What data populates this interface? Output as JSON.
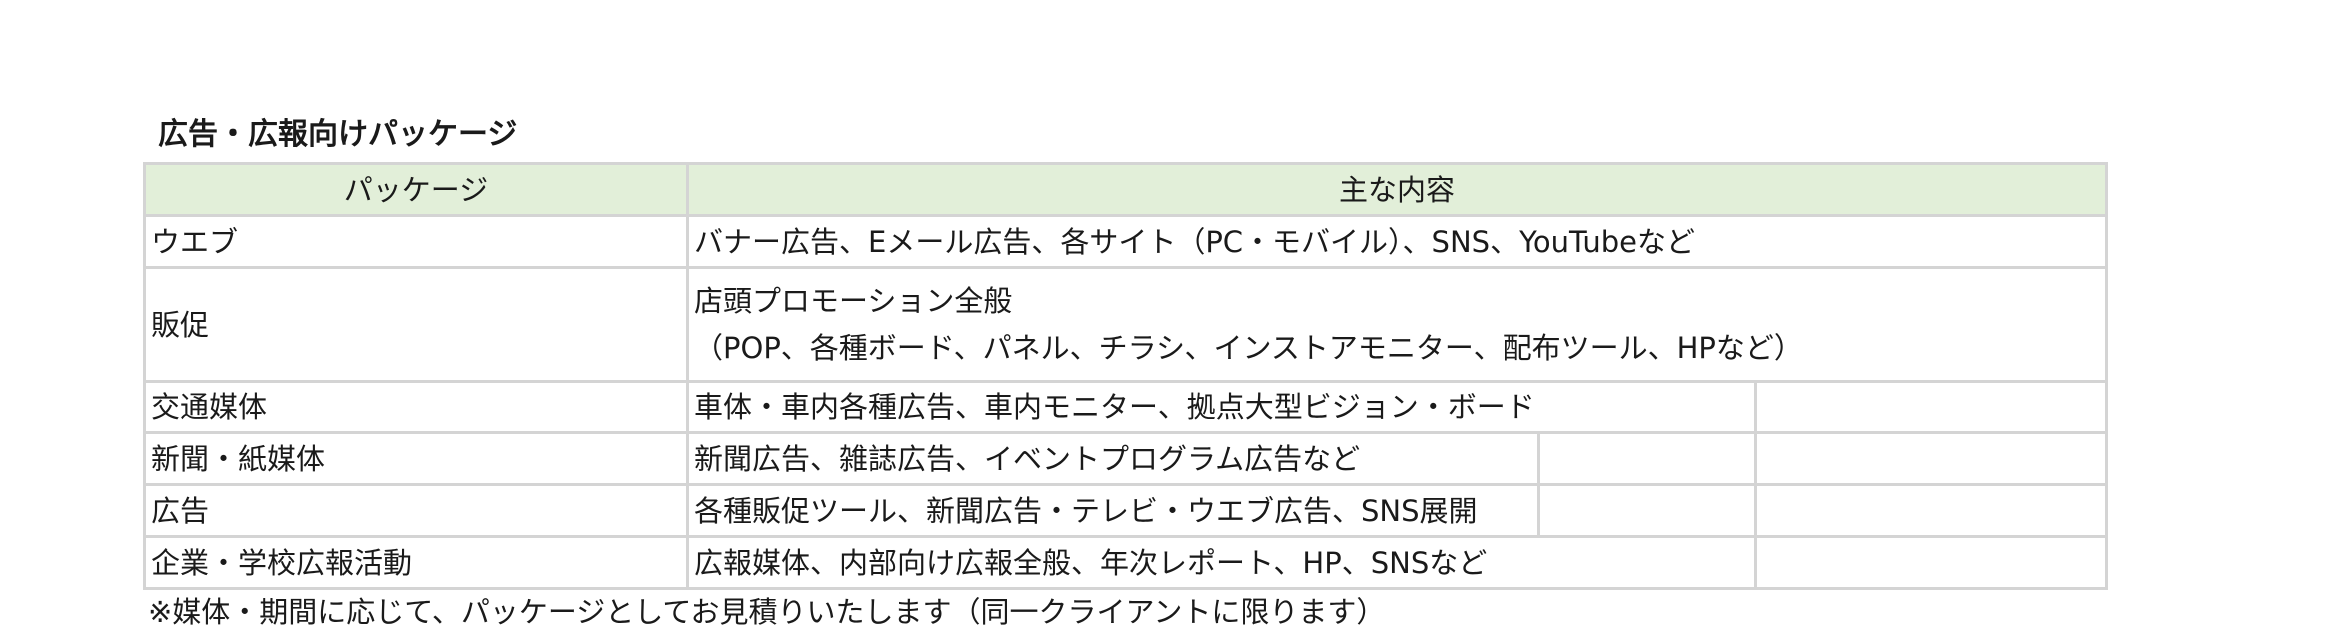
{
  "title": "広告・広報向けパッケージ",
  "table": {
    "headers": [
      "パッケージ",
      "主な内容"
    ],
    "rows": [
      {
        "package": "ウエブ",
        "content": [
          "バナー広告、Eメール広告、各サイト（PC・モバイル）、SNS、YouTubeなど"
        ]
      },
      {
        "package": "販促",
        "content": [
          "店頭プロモーション全般",
          "（POP、各種ボード、パネル、チラシ、インストアモニター、配布ツール、HPなど）"
        ]
      },
      {
        "package": "交通媒体",
        "content": [
          "車体・車内各種広告、車内モニター、拠点大型ビジョン・ボード"
        ]
      },
      {
        "package": "新聞・紙媒体",
        "content": [
          "新聞広告、雑誌広告、イベントプログラム広告など"
        ]
      },
      {
        "package": "広告",
        "content": [
          "各種販促ツール、新聞広告・テレビ・ウエブ広告、SNS展開"
        ]
      },
      {
        "package": "企業・学校広報活動",
        "content": [
          "広報媒体、内部向け広報全般、年次レポート、HP、SNSなど"
        ]
      }
    ]
  },
  "note": "※媒体・期間に応じて、パッケージとしてお見積りいたします（同一クライアントに限ります）",
  "colors": {
    "header_bg": "#e2efd9",
    "border": "#d4d4d4",
    "text": "#1a1a1a"
  }
}
